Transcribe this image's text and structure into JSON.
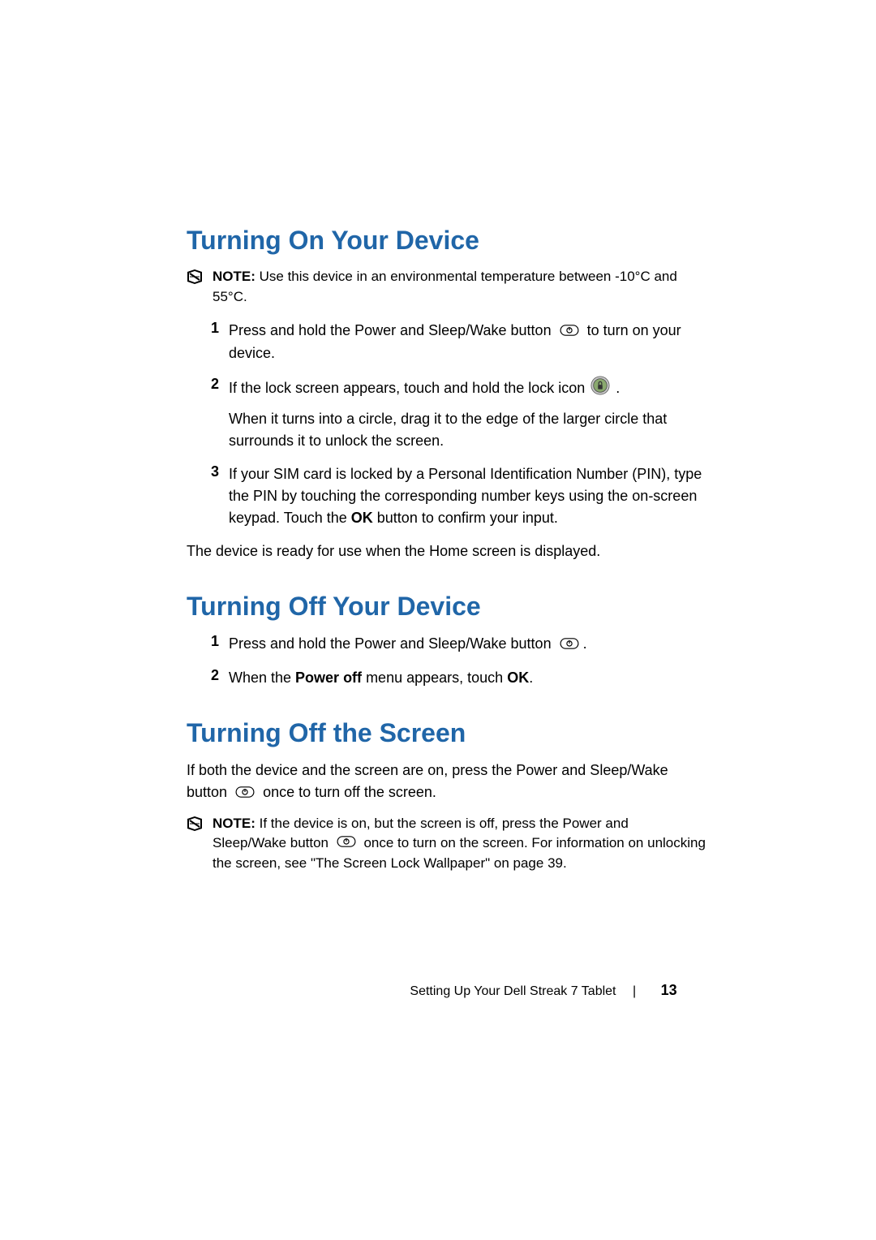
{
  "sections": {
    "turning_on": {
      "heading": "Turning On Your Device",
      "note_label": "NOTE:",
      "note_text": " Use this device in an environmental temperature between -10°C and 55°C.",
      "steps": {
        "s1": {
          "num": "1",
          "text_a": "Press and hold the Power and Sleep/Wake button ",
          "text_b": " to turn on your device."
        },
        "s2": {
          "num": "2",
          "text_a": "If the lock screen appears, touch and hold the lock icon ",
          "text_b": ".",
          "sub": "When it turns into a circle, drag it to the edge of the larger circle that surrounds it to unlock the screen."
        },
        "s3": {
          "num": "3",
          "text_a": "If your SIM card is locked by a Personal Identification Number (PIN), type the PIN by touching the corresponding number keys using the on-screen keypad. Touch the ",
          "ok": "OK",
          "text_b": " button to confirm your input."
        }
      },
      "closing": "The device is ready for use when the Home screen is displayed."
    },
    "turning_off_device": {
      "heading": "Turning Off Your Device",
      "steps": {
        "s1": {
          "num": "1",
          "text_a": "Press and hold the Power and Sleep/Wake button ",
          "text_b": "."
        },
        "s2": {
          "num": "2",
          "text_a": "When the ",
          "bold": "Power off",
          "text_b": " menu appears, touch ",
          "ok": "OK",
          "text_c": "."
        }
      }
    },
    "turning_off_screen": {
      "heading": "Turning Off the Screen",
      "para_a": "If both the device and the screen are on, press the Power and Sleep/Wake button ",
      "para_b": " once to turn off the screen.",
      "note_label": "NOTE:",
      "note_text_a": " If the device is on, but the screen is off, press the Power and Sleep/Wake button ",
      "note_text_b": " once to turn on the screen. For information on unlocking the screen, see \"The Screen Lock Wallpaper\" on page 39."
    }
  },
  "footer": {
    "text": "Setting Up Your Dell Streak 7 Tablet",
    "page": "13"
  }
}
